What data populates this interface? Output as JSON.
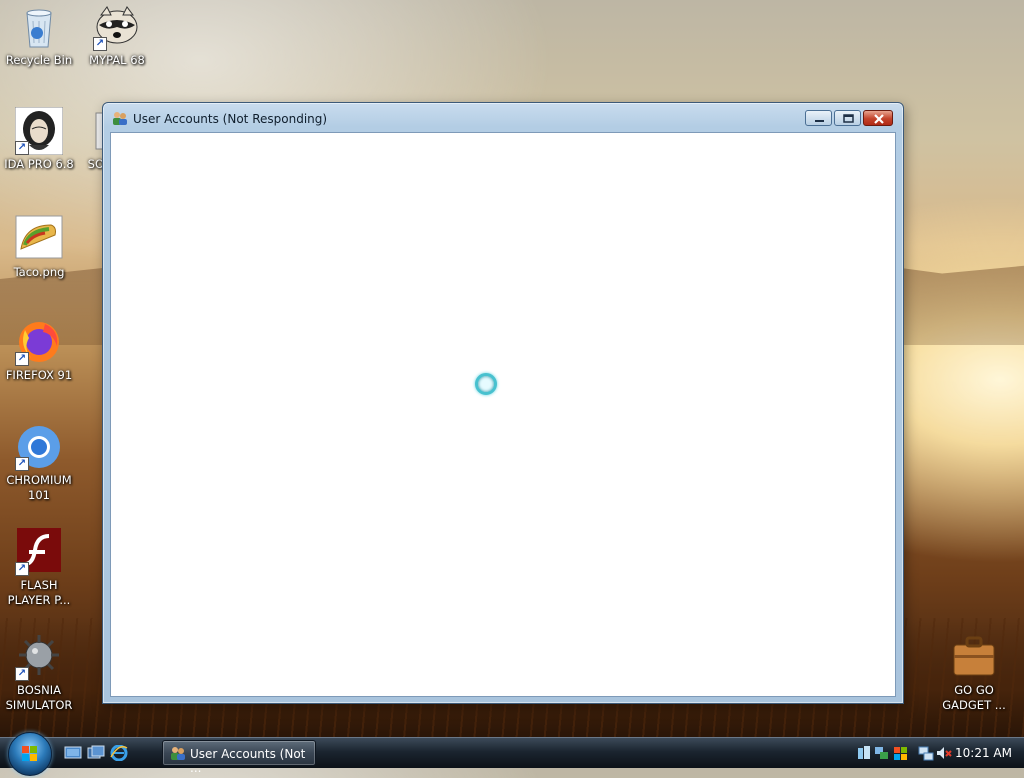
{
  "desktop": {
    "icons": [
      {
        "id": "recycle",
        "label": "Recycle Bin"
      },
      {
        "id": "mypal",
        "label": "MYPAL 68"
      },
      {
        "id": "idapro",
        "label": "IDA PRO 6.8"
      },
      {
        "id": "so",
        "label": "SO"
      },
      {
        "id": "taco",
        "label": "Taco.png"
      },
      {
        "id": "firefox",
        "label": "FIREFOX 91"
      },
      {
        "id": "chromium",
        "label": "CHROMIUM 101"
      },
      {
        "id": "flash",
        "label": "FLASH PLAYER P..."
      },
      {
        "id": "bosnia",
        "label": "BOSNIA SIMULATOR"
      },
      {
        "id": "gogo",
        "label": "GO GO GADGET ..."
      }
    ]
  },
  "window": {
    "title": "User Accounts (Not Responding)",
    "icon": "users-icon",
    "controls": [
      "minimize",
      "maximize",
      "close"
    ],
    "state": "busy"
  },
  "taskbar": {
    "quick_launch": [
      "show-desktop-icon",
      "switch-windows-icon",
      "internet-explorer-icon"
    ],
    "active_task_label": "User Accounts (Not ...",
    "clock": "10:21 AM",
    "tray_icons": [
      "device-icon",
      "network-icon",
      "windows-icon",
      "network-status-icon",
      "volume-muted-icon"
    ]
  },
  "colors": {
    "title_text": "#0f1e2d",
    "close_button": "#c3432b",
    "spinner": "#48c1cf"
  }
}
